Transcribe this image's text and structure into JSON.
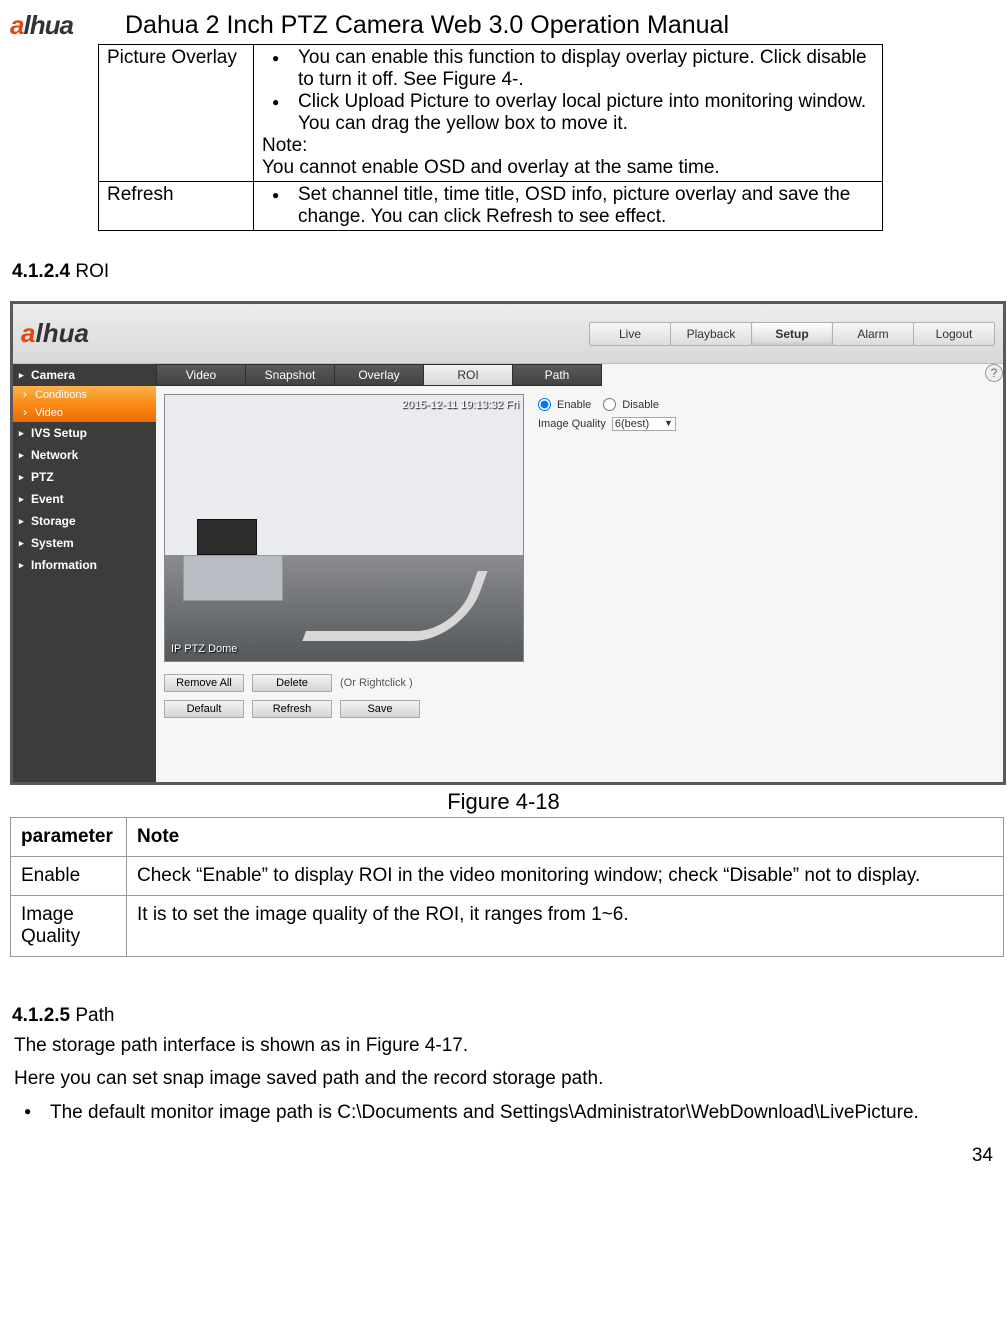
{
  "header": {
    "logo_text_pre": "a",
    "logo_text_mid": "lhua",
    "doc_title": "Dahua 2 Inch PTZ Camera Web 3.0 Operation Manual"
  },
  "table1": {
    "r1_label": "Picture Overlay",
    "r1_b1": "You can enable this function to display overlay picture. Click disable to turn it off. See Figure 4-.",
    "r1_b2": "Click Upload Picture to overlay local picture into monitoring window. You can drag the yellow box to move it.",
    "r1_note_label": "Note:",
    "r1_note_text": "You cannot enable OSD and overlay at the same time.",
    "r2_label": "Refresh",
    "r2_b1": "Set channel title, time title, OSD info, picture overlay and save the change. You can click Refresh to see effect."
  },
  "section_roi": {
    "num": "4.1.2.4",
    "title": " ROI"
  },
  "screenshot": {
    "nav": {
      "live": "Live",
      "playback": "Playback",
      "setup": "Setup",
      "alarm": "Alarm",
      "logout": "Logout"
    },
    "sidebar": {
      "camera": "Camera",
      "conditions": "Conditions",
      "video": "Video",
      "ivs": "IVS Setup",
      "network": "Network",
      "ptz": "PTZ",
      "event": "Event",
      "storage": "Storage",
      "system": "System",
      "information": "Information"
    },
    "tabs": {
      "video": "Video",
      "snapshot": "Snapshot",
      "overlay": "Overlay",
      "roi": "ROI",
      "path": "Path"
    },
    "preview": {
      "timestamp": "2015-12-11 19:13:32 Fri",
      "label": "IP PTZ Dome"
    },
    "controls": {
      "enable": "Enable",
      "disable": "Disable",
      "image_quality": "Image Quality",
      "quality_value": "6(best)"
    },
    "buttons": {
      "remove_all": "Remove All",
      "delete": "Delete",
      "hint": "(Or Rightclick )",
      "default": "Default",
      "refresh": "Refresh",
      "save": "Save"
    },
    "help": "?"
  },
  "figure_caption": "Figure 4-18",
  "table2": {
    "h1": "parameter",
    "h2": "Note",
    "r1c1": "Enable",
    "r1c2": "Check “Enable” to display ROI in the video monitoring window; check “Disable” not to display.",
    "r2c1": "Image Quality",
    "r2c2": "It is to set the image quality of the ROI, it ranges from 1~6."
  },
  "section_path": {
    "num": "4.1.2.5",
    "title": " Path",
    "p1": "The storage path interface is shown as in Figure 4-17.",
    "p2": "Here you can set snap image saved path and the record storage path.",
    "b1": "The default monitor image path is C:\\Documents and Settings\\Administrator\\WebDownload\\LivePicture."
  },
  "page_num": "34"
}
